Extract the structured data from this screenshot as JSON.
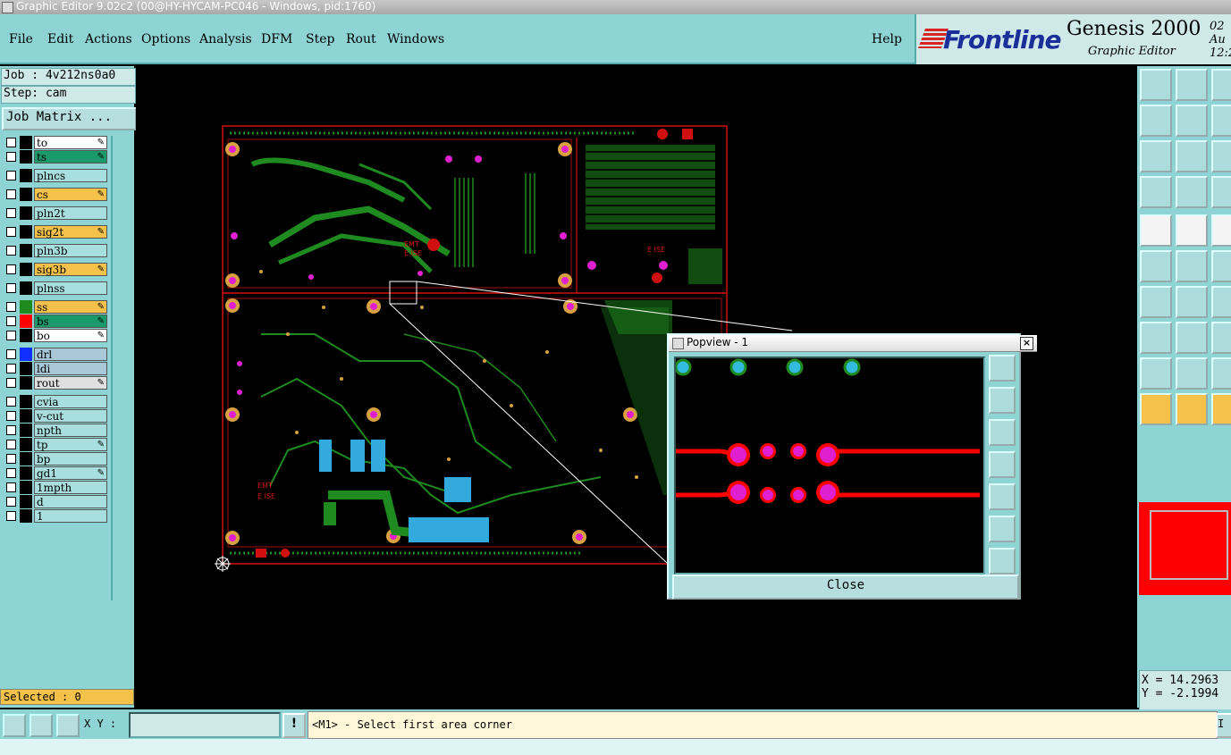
{
  "window_title": "Graphic Editor 9.02c2 (00@HY-HYCAM-PC046 - Windows, pid:1760)",
  "menu": [
    {
      "label": "File"
    },
    {
      "label": "Edit"
    },
    {
      "label": "Actions"
    },
    {
      "label": "Options"
    },
    {
      "label": "Analysis"
    },
    {
      "label": "DFM"
    },
    {
      "label": "Step"
    },
    {
      "label": "Rout"
    },
    {
      "label": "Windows"
    }
  ],
  "help_label": "Help",
  "brand": {
    "logo": "Frontline",
    "product": "Genesis 2000",
    "subtitle": "Graphic Editor",
    "date_line1": "02 Au",
    "date_line2": "12:2"
  },
  "job_label": "Job : 4v212ns0a0",
  "step_label": "Step: cam",
  "job_matrix_label": "Job Matrix ...",
  "layers": [
    {
      "name": "to",
      "color": "#ffffff",
      "edit": true
    },
    {
      "name": "ts",
      "color": "#1a9a6a",
      "edit": true
    },
    {
      "name": "plncs",
      "color": "#a8dede",
      "edit": false
    },
    {
      "name": "cs",
      "color": "#f4c24a",
      "edit": true
    },
    {
      "name": "pln2t",
      "color": "#a8dede",
      "edit": false
    },
    {
      "name": "sig2t",
      "color": "#f4c24a",
      "edit": true
    },
    {
      "name": "pln3b",
      "color": "#a8dede",
      "edit": false
    },
    {
      "name": "sig3b",
      "color": "#f4c24a",
      "edit": true
    },
    {
      "name": "plnss",
      "color": "#a8dede",
      "edit": false
    },
    {
      "name": "ss",
      "color": "#f4c24a",
      "edit": true
    },
    {
      "name": "bs",
      "color": "#1a9a6a",
      "edit": true
    },
    {
      "name": "bo",
      "color": "#ffffff",
      "edit": true
    },
    {
      "name": "drl",
      "color": "#a8c8d8",
      "edit": false
    },
    {
      "name": "ldi",
      "color": "#a8c8d8",
      "edit": false
    },
    {
      "name": "rout",
      "color": "#e0e0e0",
      "edit": true
    },
    {
      "name": "cvia",
      "color": "#a8dede",
      "edit": false
    },
    {
      "name": "v-cut",
      "color": "#a8dede",
      "edit": false
    },
    {
      "name": "npth",
      "color": "#a8dede",
      "edit": false
    },
    {
      "name": "tp",
      "color": "#a8dede",
      "edit": true
    },
    {
      "name": "bp",
      "color": "#a8dede",
      "edit": false
    },
    {
      "name": "gd1",
      "color": "#a8dede",
      "edit": true
    },
    {
      "name": "1mpth",
      "color": "#a8dede",
      "edit": false
    },
    {
      "name": "d",
      "color": "#a8dede",
      "edit": false
    },
    {
      "name": "1",
      "color": "#a8dede",
      "edit": false
    }
  ],
  "selected_label": "Selected : 0",
  "xy_label": "X Y :",
  "xy_value": "",
  "bang_label": "!",
  "prompt_text": "<M1> - Select first area corner",
  "prompt_end": "I",
  "coords": {
    "x": "X = 14.2963",
    "y": "Y = -2.1994"
  },
  "popview": {
    "title": "Popview - 1",
    "close_x": "×",
    "close_label": "Close"
  },
  "colors": {
    "panel": "#8fd4d4",
    "board_outline": "#d01010",
    "trace_green": "#1f8a1f",
    "pad_magenta": "#e020d0",
    "pad_cyan": "#33bbdd",
    "selection": "#ff0000"
  }
}
